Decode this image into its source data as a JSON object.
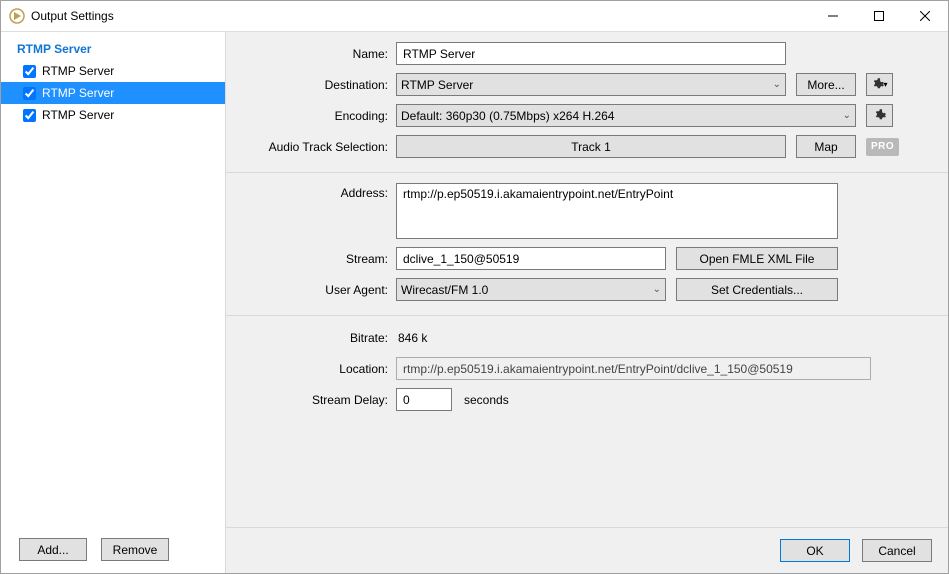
{
  "window": {
    "title": "Output Settings"
  },
  "sidebar": {
    "header": "RTMP Server",
    "items": [
      {
        "label": "RTMP Server",
        "checked": true
      },
      {
        "label": "RTMP Server",
        "checked": true
      },
      {
        "label": "RTMP Server",
        "checked": true
      }
    ],
    "add_label": "Add...",
    "remove_label": "Remove"
  },
  "panel1": {
    "name_label": "Name:",
    "name_value": "RTMP Server",
    "destination_label": "Destination:",
    "destination_value": "RTMP Server",
    "more_label": "More...",
    "encoding_label": "Encoding:",
    "encoding_value": "Default: 360p30 (0.75Mbps) x264 H.264",
    "audio_label": "Audio Track Selection:",
    "audio_track_value": "Track 1",
    "map_label": "Map",
    "pro_label": "PRO"
  },
  "panel2": {
    "address_label": "Address:",
    "address_value": "rtmp://p.ep50519.i.akamaientrypoint.net/EntryPoint",
    "stream_label": "Stream:",
    "stream_value": "dclive_1_150@50519",
    "open_fmle_label": "Open FMLE XML File",
    "useragent_label": "User Agent:",
    "useragent_value": "Wirecast/FM 1.0",
    "credentials_label": "Set Credentials..."
  },
  "panel3": {
    "bitrate_label": "Bitrate:",
    "bitrate_value": "846 k",
    "location_label": "Location:",
    "location_value": "rtmp://p.ep50519.i.akamaientrypoint.net/EntryPoint/dclive_1_150@50519",
    "delay_label": "Stream Delay:",
    "delay_value": "0",
    "delay_unit": "seconds"
  },
  "footer": {
    "ok_label": "OK",
    "cancel_label": "Cancel"
  }
}
